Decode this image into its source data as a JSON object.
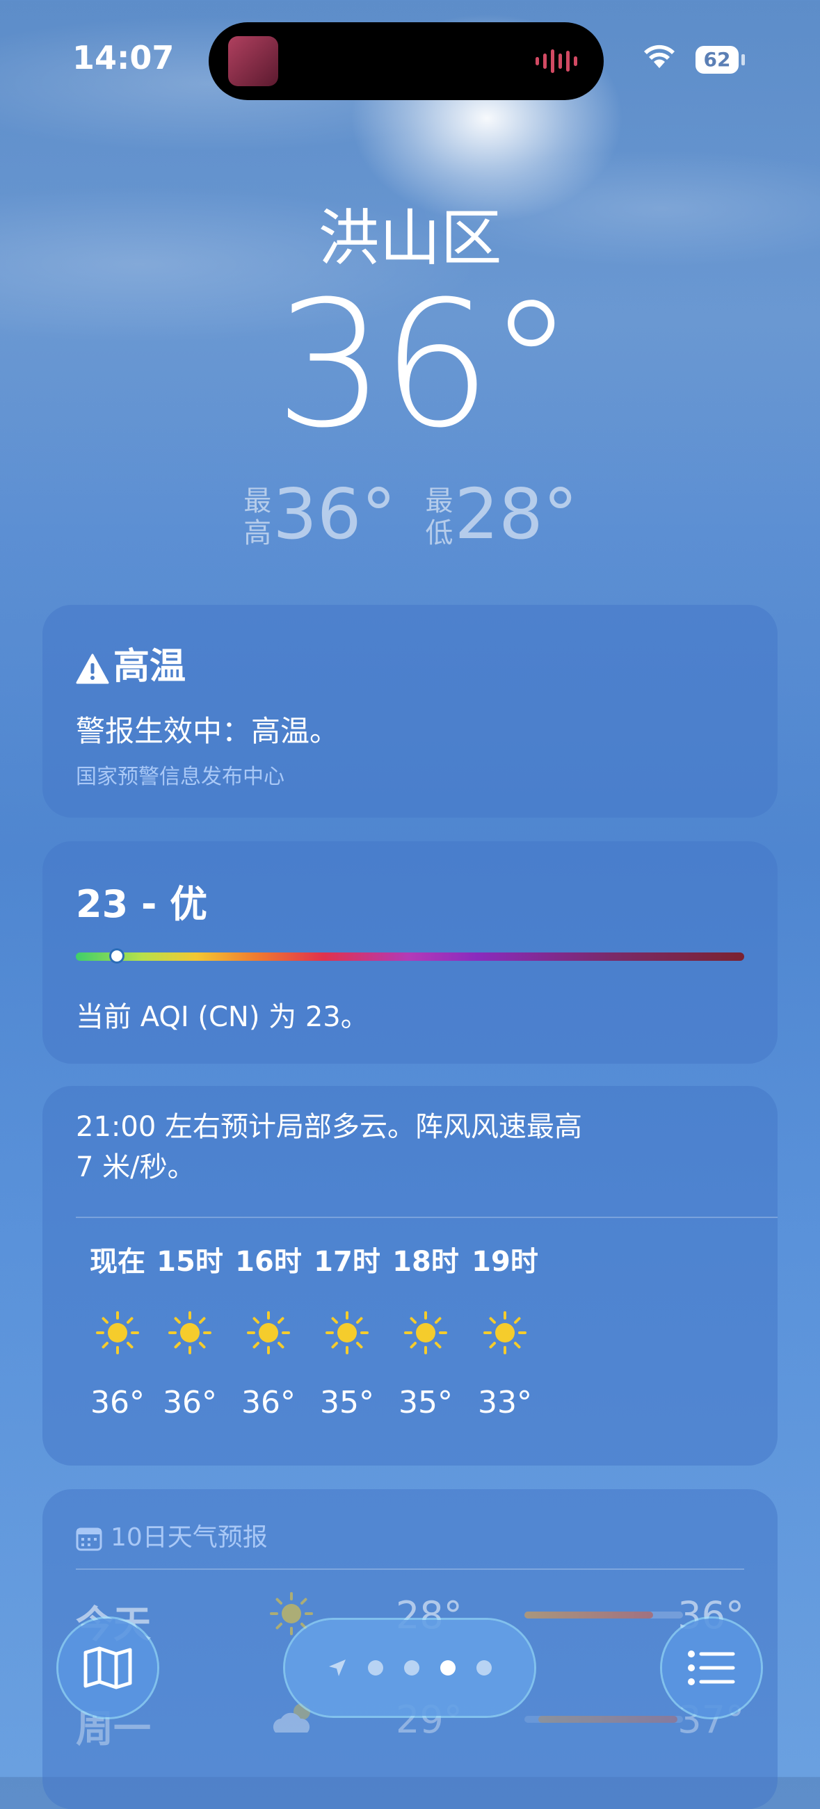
{
  "status": {
    "time": "14:07",
    "battery": "62"
  },
  "location": {
    "city": "洪山区",
    "temperature": "36°",
    "high_tag": "最高",
    "high": "36°",
    "low_tag": "最低",
    "low": "28°"
  },
  "alert": {
    "title": "高温",
    "text": "警报生效中：高温。",
    "source": "国家预警信息发布中心"
  },
  "aqi": {
    "title": "23 - 优",
    "value": 23,
    "description": "当前 AQI (CN) 为 23。"
  },
  "hourly": {
    "summary_line1": "21:00 左右预计局部多云。阵风风速最高",
    "summary_line2": "7 米/秒。",
    "hours": [
      {
        "label": "现在",
        "icon": "sun-icon",
        "temp": "36°"
      },
      {
        "label": "15时",
        "icon": "sun-icon",
        "temp": "36°"
      },
      {
        "label": "16时",
        "icon": "sun-icon",
        "temp": "36°"
      },
      {
        "label": "17时",
        "icon": "sun-icon",
        "temp": "35°"
      },
      {
        "label": "18时",
        "icon": "sun-icon",
        "temp": "35°"
      },
      {
        "label": "19时",
        "icon": "sun-icon",
        "temp": "33°"
      }
    ]
  },
  "forecast": {
    "header": "10日天气预报",
    "days": [
      {
        "day": "今天",
        "icon": "sun-icon",
        "low": "28°",
        "high": "36°"
      },
      {
        "day": "周一",
        "icon": "partly-cloudy-icon",
        "low": "29°",
        "high": "37°"
      }
    ]
  },
  "pager": {
    "page_count": 4,
    "active_page": 3
  },
  "colors": {
    "sun": "#f5cc2c",
    "accent_text": "#a9c8f6"
  }
}
